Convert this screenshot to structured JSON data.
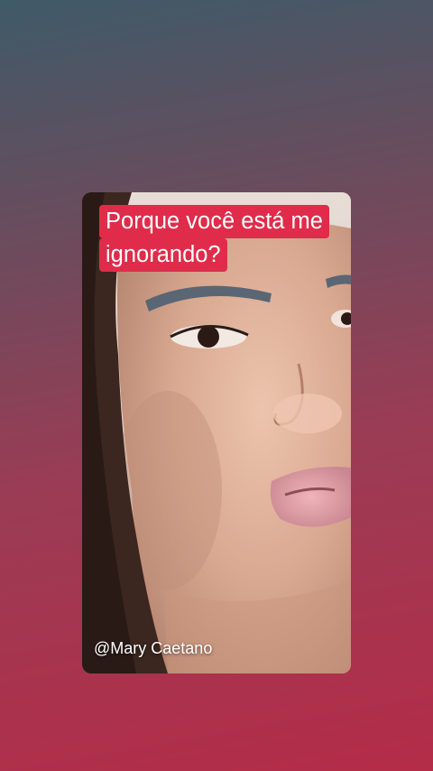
{
  "caption": {
    "line1": "Porque você está me",
    "line2": "ignorando?",
    "highlight_color": "#e02c4a"
  },
  "watermark": {
    "handle": "@Mary Caetano"
  },
  "colors": {
    "background_top": "#3f5a68",
    "background_bottom": "#b42c48"
  }
}
